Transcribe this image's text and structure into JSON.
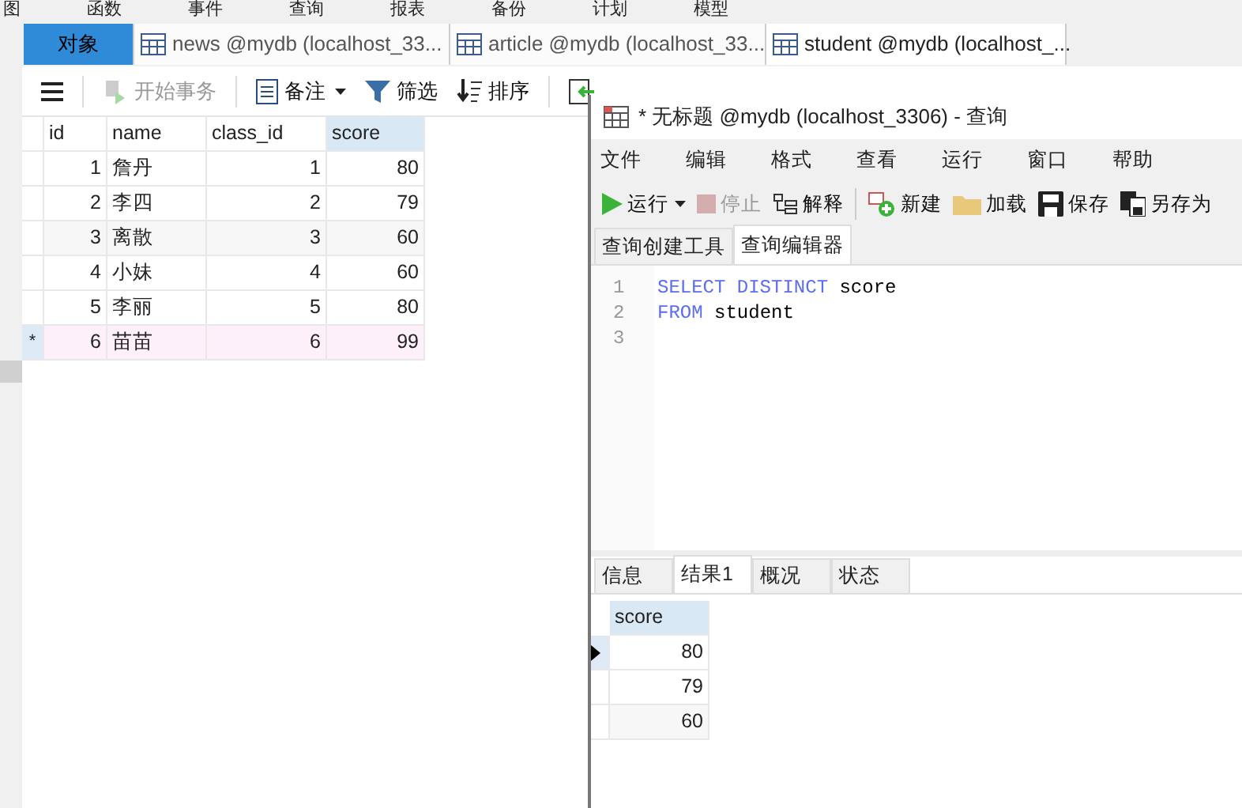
{
  "menu": [
    "图",
    "函数",
    "事件",
    "查询",
    "报表",
    "备份",
    "计划",
    "模型"
  ],
  "tabs": [
    {
      "label": "对象",
      "kind": "objects",
      "selected": true
    },
    {
      "label": "news @mydb (localhost_33...",
      "kind": "table",
      "selected": false
    },
    {
      "label": "article @mydb (localhost_33...",
      "kind": "table",
      "selected": false
    },
    {
      "label": "student @mydb (localhost_...",
      "kind": "table",
      "selected": false
    }
  ],
  "toolbar": [
    {
      "label": "开始事务",
      "kind": "transaction",
      "disabled": true
    },
    {
      "label": "备注",
      "kind": "memo",
      "disabled": false
    },
    {
      "label": "筛选",
      "kind": "filter",
      "disabled": false
    },
    {
      "label": "排序",
      "kind": "sort",
      "disabled": false
    }
  ],
  "grid": {
    "columns": [
      "id",
      "name",
      "class_id",
      "score"
    ],
    "rows": [
      {
        "cells": [
          "1",
          "詹丹",
          "1",
          "80"
        ],
        "new": false
      },
      {
        "cells": [
          "2",
          "李四",
          "2",
          "79"
        ],
        "new": false
      },
      {
        "cells": [
          "3",
          "离散",
          "3",
          "60"
        ],
        "new": false
      },
      {
        "cells": [
          "4",
          "小妹",
          "4",
          "60"
        ],
        "new": false
      },
      {
        "cells": [
          "5",
          "李丽",
          "5",
          "80"
        ],
        "new": false
      },
      {
        "cells": [
          "6",
          "苗苗",
          "6",
          "99"
        ],
        "new": true,
        "marker": "*"
      }
    ]
  },
  "query_window": {
    "title": "* 无标题 @mydb (localhost_3306) - 查询",
    "menu": [
      "文件",
      "编辑",
      "格式",
      "查看",
      "运行",
      "窗口",
      "帮助"
    ],
    "toolbar": [
      {
        "label": "运行",
        "kind": "run",
        "disabled": false
      },
      {
        "label": "停止",
        "kind": "stop",
        "disabled": true
      },
      {
        "label": "解释",
        "kind": "explain",
        "disabled": false
      },
      {
        "label": "新建",
        "kind": "new",
        "disabled": false
      },
      {
        "label": "加载",
        "kind": "load",
        "disabled": false
      },
      {
        "label": "保存",
        "kind": "save",
        "disabled": false
      },
      {
        "label": "另存为",
        "kind": "saveas",
        "disabled": false
      }
    ],
    "subtabs": [
      {
        "label": "查询创建工具",
        "selected": false
      },
      {
        "label": "查询编辑器",
        "selected": true
      }
    ],
    "line_numbers": [
      "1",
      "2",
      "3"
    ],
    "code": [
      [
        {
          "t": "SELECT DISTINCT",
          "kw": true
        },
        {
          "t": " score",
          "kw": false
        }
      ],
      [
        {
          "t": "FROM",
          "kw": true
        },
        {
          "t": " student",
          "kw": false
        }
      ]
    ],
    "result_tabs": [
      {
        "label": "信息",
        "selected": false
      },
      {
        "label": "结果1",
        "selected": true
      },
      {
        "label": "概况",
        "selected": false
      },
      {
        "label": "状态",
        "selected": false
      }
    ],
    "result": {
      "columns": [
        "score"
      ],
      "rows": [
        {
          "cells": [
            "80"
          ],
          "current": true
        },
        {
          "cells": [
            "79"
          ],
          "current": false
        },
        {
          "cells": [
            "60"
          ],
          "current": false
        }
      ]
    }
  }
}
